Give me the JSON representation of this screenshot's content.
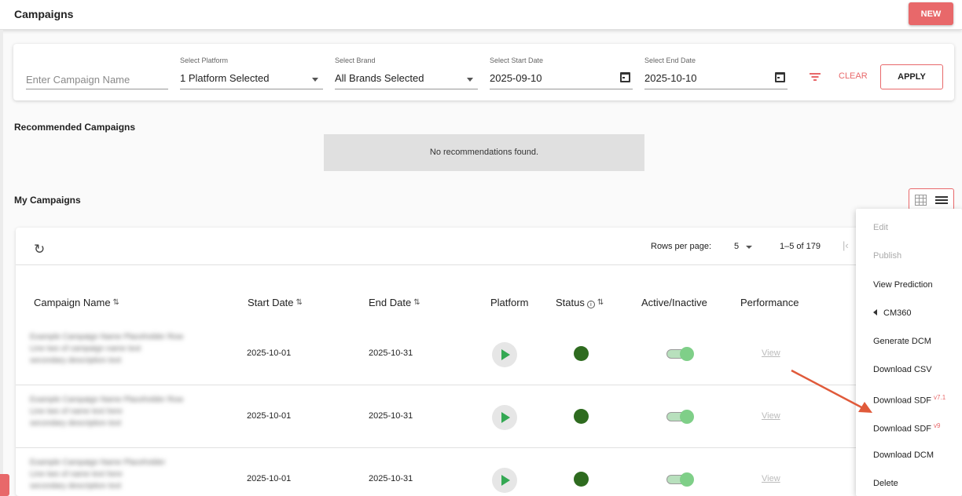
{
  "header": {
    "title": "Campaigns",
    "new_label": "NEW"
  },
  "filters": {
    "campaign_name_placeholder": "Enter Campaign Name",
    "platform_label": "Select Platform",
    "platform_value": "1 Platform Selected",
    "brand_label": "Select Brand",
    "brand_value": "All Brands Selected",
    "start_label": "Select Start Date",
    "start_value": "2025-09-10",
    "end_label": "Select End Date",
    "end_value": "2025-10-10",
    "clear_label": "CLEAR",
    "apply_label": "APPLY"
  },
  "recommended": {
    "title": "Recommended Campaigns",
    "empty_text": "No recommendations found."
  },
  "my_campaigns": {
    "title": "My Campaigns",
    "rows_per_page_label": "Rows per page:",
    "rows_per_page_value": "5",
    "page_info": "1–5 of 179",
    "columns": [
      "Campaign Name",
      "Start Date",
      "End Date",
      "Platform",
      "Status",
      "Active/Inactive",
      "Performance"
    ],
    "rows": [
      {
        "start": "2025-10-01",
        "end": "2025-10-31",
        "view": "View"
      },
      {
        "start": "2025-10-01",
        "end": "2025-10-31",
        "view": "View"
      },
      {
        "start": "2025-10-01",
        "end": "2025-10-31",
        "view": "View"
      }
    ]
  },
  "context_menu": {
    "items": [
      "Edit",
      "Publish",
      "View Prediction",
      "CM360",
      "Generate DCM",
      "Download CSV",
      "Download SDF",
      "Download SDF",
      "Download DCM",
      "Delete"
    ],
    "sdf1_version": "v7.1",
    "sdf2_version": "v9"
  },
  "colors": {
    "accent": "#e8686a",
    "status_active": "#2e6b1f",
    "platform_icon": "#34a853",
    "annotation_arrow": "#e05a3a"
  }
}
